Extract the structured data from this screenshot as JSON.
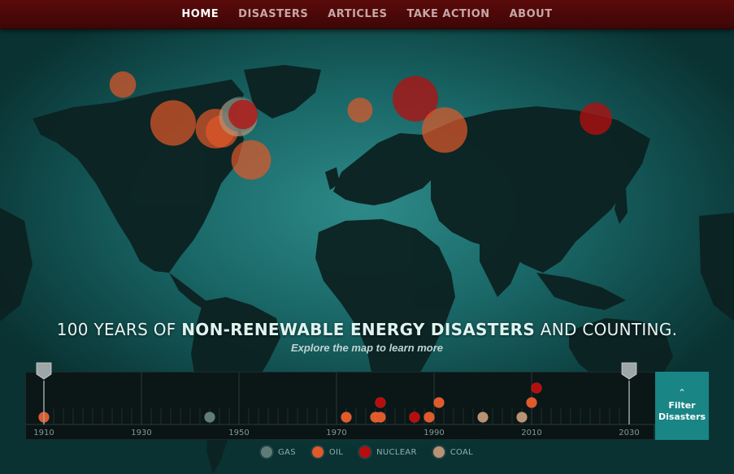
{
  "nav": {
    "items": [
      {
        "label": "HOME",
        "active": true
      },
      {
        "label": "DISASTERS",
        "active": false
      },
      {
        "label": "ARTICLES",
        "active": false
      },
      {
        "label": "TAKE ACTION",
        "active": false
      },
      {
        "label": "ABOUT",
        "active": false
      }
    ]
  },
  "headline": {
    "part1": "100 YEARS OF ",
    "part2": "NON-RENEWABLE ENERGY DISASTERS",
    "part3": " AND COUNTING."
  },
  "subhead": "Explore the map to learn more",
  "timeline": {
    "start_year": 1910,
    "end_year": 2030,
    "range_start": 1910,
    "range_end": 2030,
    "tick_labels": [
      "1910",
      "1930",
      "1950",
      "1970",
      "1990",
      "2010",
      "2030"
    ],
    "events": [
      {
        "year": 1910,
        "type": "oil",
        "row": 0
      },
      {
        "year": 1944,
        "type": "gas",
        "row": 0
      },
      {
        "year": 1972,
        "type": "oil",
        "row": 0
      },
      {
        "year": 1978,
        "type": "oil",
        "row": 0
      },
      {
        "year": 1979,
        "type": "oil",
        "row": 0
      },
      {
        "year": 1979,
        "type": "nuclear",
        "row": 1
      },
      {
        "year": 1986,
        "type": "nuclear",
        "row": 0
      },
      {
        "year": 1989,
        "type": "oil",
        "row": 0
      },
      {
        "year": 1991,
        "type": "oil",
        "row": 1
      },
      {
        "year": 2000,
        "type": "coal",
        "row": 0
      },
      {
        "year": 2008,
        "type": "coal",
        "row": 0
      },
      {
        "year": 2010,
        "type": "oil",
        "row": 1
      },
      {
        "year": 2011,
        "type": "nuclear",
        "row": 2
      }
    ]
  },
  "filter_button": {
    "label": "Filter Disasters"
  },
  "legend": [
    {
      "label": "GAS",
      "type": "gas"
    },
    {
      "label": "OIL",
      "type": "oil"
    },
    {
      "label": "NUCLEAR",
      "type": "nuclear"
    },
    {
      "label": "COAL",
      "type": "coal"
    }
  ],
  "colors": {
    "gas": "#5f7c78",
    "oil": "#e2592a",
    "nuclear": "#b80d0d",
    "coal": "#b89373",
    "nav_bg": "#4a0808",
    "filter_bg": "#1a8585"
  },
  "map_bubbles": [
    {
      "type": "oil",
      "lon": -150,
      "lat": 61,
      "magnitude": 0.35
    },
    {
      "type": "oil",
      "lon": -119,
      "lat": 34,
      "magnitude": 1.0
    },
    {
      "type": "oil",
      "lon": -93,
      "lat": 30,
      "magnitude": 0.8
    },
    {
      "type": "oil",
      "lon": -89,
      "lat": 28,
      "magnitude": 0.55
    },
    {
      "type": "coal",
      "lon": -79,
      "lat": 38,
      "magnitude": 0.75
    },
    {
      "type": "gas",
      "lon": -78,
      "lat": 40,
      "magnitude": 0.65
    },
    {
      "type": "nuclear",
      "lon": -76,
      "lat": 40,
      "magnitude": 0.45
    },
    {
      "type": "oil",
      "lon": -71,
      "lat": 8,
      "magnitude": 0.8
    },
    {
      "type": "oil",
      "lon": -4,
      "lat": 43,
      "magnitude": 0.3
    },
    {
      "type": "nuclear",
      "lon": 30,
      "lat": 51,
      "magnitude": 1.0
    },
    {
      "type": "oil",
      "lon": 48,
      "lat": 29,
      "magnitude": 1.0
    },
    {
      "type": "nuclear",
      "lon": 141,
      "lat": 37,
      "magnitude": 0.55
    }
  ]
}
